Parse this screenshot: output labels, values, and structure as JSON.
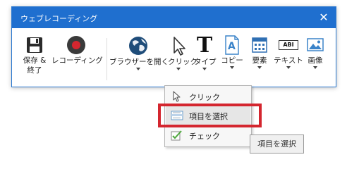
{
  "window": {
    "title": "ウェブレコーディング",
    "close_symbol": "✕"
  },
  "toolbar": {
    "save": {
      "label_line1": "保存 &",
      "label_line2": "終了",
      "icon": "save-disk-icon"
    },
    "record": {
      "label": "レコーディング",
      "icon": "record-icon"
    },
    "browser": {
      "label": "ブラウザーを開く",
      "icon": "globe-browser-icon"
    },
    "click": {
      "label": "クリック",
      "icon": "cursor-arrow-icon"
    },
    "type": {
      "label": "タイプ",
      "glyph": "T",
      "icon": "text-type-icon"
    },
    "copy": {
      "label": "コピー",
      "glyph": "A",
      "icon": "copy-document-icon"
    },
    "element": {
      "label": "要素",
      "icon": "element-grid-icon"
    },
    "text": {
      "label": "テキスト",
      "glyph": "ABI",
      "icon": "text-field-icon"
    },
    "image": {
      "label": "画像",
      "icon": "image-picture-icon"
    }
  },
  "dropdown": {
    "items": [
      {
        "label": "クリック",
        "icon": "cursor-arrow-icon",
        "selected": false
      },
      {
        "label": "項目を選択",
        "icon": "select-list-icon",
        "selected": true
      },
      {
        "label": "チェック",
        "icon": "checkbox-check-icon",
        "selected": false
      }
    ]
  },
  "tooltip": {
    "text": "項目を選択"
  },
  "colors": {
    "titlebar": "#1f6fcf",
    "highlight_box": "#d4262f",
    "record": "#d4262f",
    "selected_item": "#e6e6e6"
  }
}
